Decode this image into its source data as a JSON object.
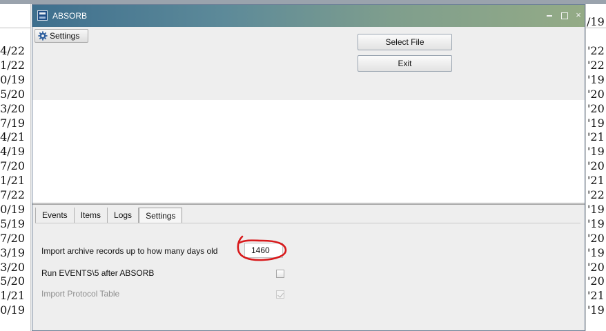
{
  "background": {
    "left_dates": [
      "4/22",
      "1/22",
      "0/19",
      "5/20",
      "3/20",
      "7/19",
      "4/21",
      "4/19",
      "7/20",
      "1/21",
      "7/22",
      "0/19",
      "5/19",
      "7/20",
      "3/19",
      "3/20",
      "5/20",
      "1/21",
      "0/19"
    ],
    "right_header": "/19",
    "right_dates": [
      "'22",
      "'22",
      "'19",
      "'20",
      "'20",
      "'19",
      "'21",
      "'19",
      "'20",
      "'21",
      "'22",
      "'19",
      "'19",
      "'20",
      "'19",
      "'20",
      "'20",
      "'21",
      "'19"
    ]
  },
  "window": {
    "title": "ABSORB",
    "controls": {
      "minimize_icon": "minimize-icon",
      "maximize_icon": "maximize-icon",
      "close_glyph": "×"
    }
  },
  "toolbar": {
    "settings_label": "Settings",
    "select_file_label": "Select File",
    "exit_label": "Exit"
  },
  "tabs": [
    {
      "label": "Events",
      "active": false
    },
    {
      "label": "Items",
      "active": false
    },
    {
      "label": "Logs",
      "active": false
    },
    {
      "label": "Settings",
      "active": true
    }
  ],
  "settings": {
    "archive_days": {
      "label": "Import archive records up to how many days old",
      "value": "1460"
    },
    "run_events": {
      "label": "Run EVENTS\\5 after ABSORB",
      "checked": false,
      "disabled": false
    },
    "import_protocol": {
      "label": "Import Protocol Table",
      "checked": true,
      "disabled": true
    }
  },
  "annotation": {
    "color": "#d8191b"
  }
}
